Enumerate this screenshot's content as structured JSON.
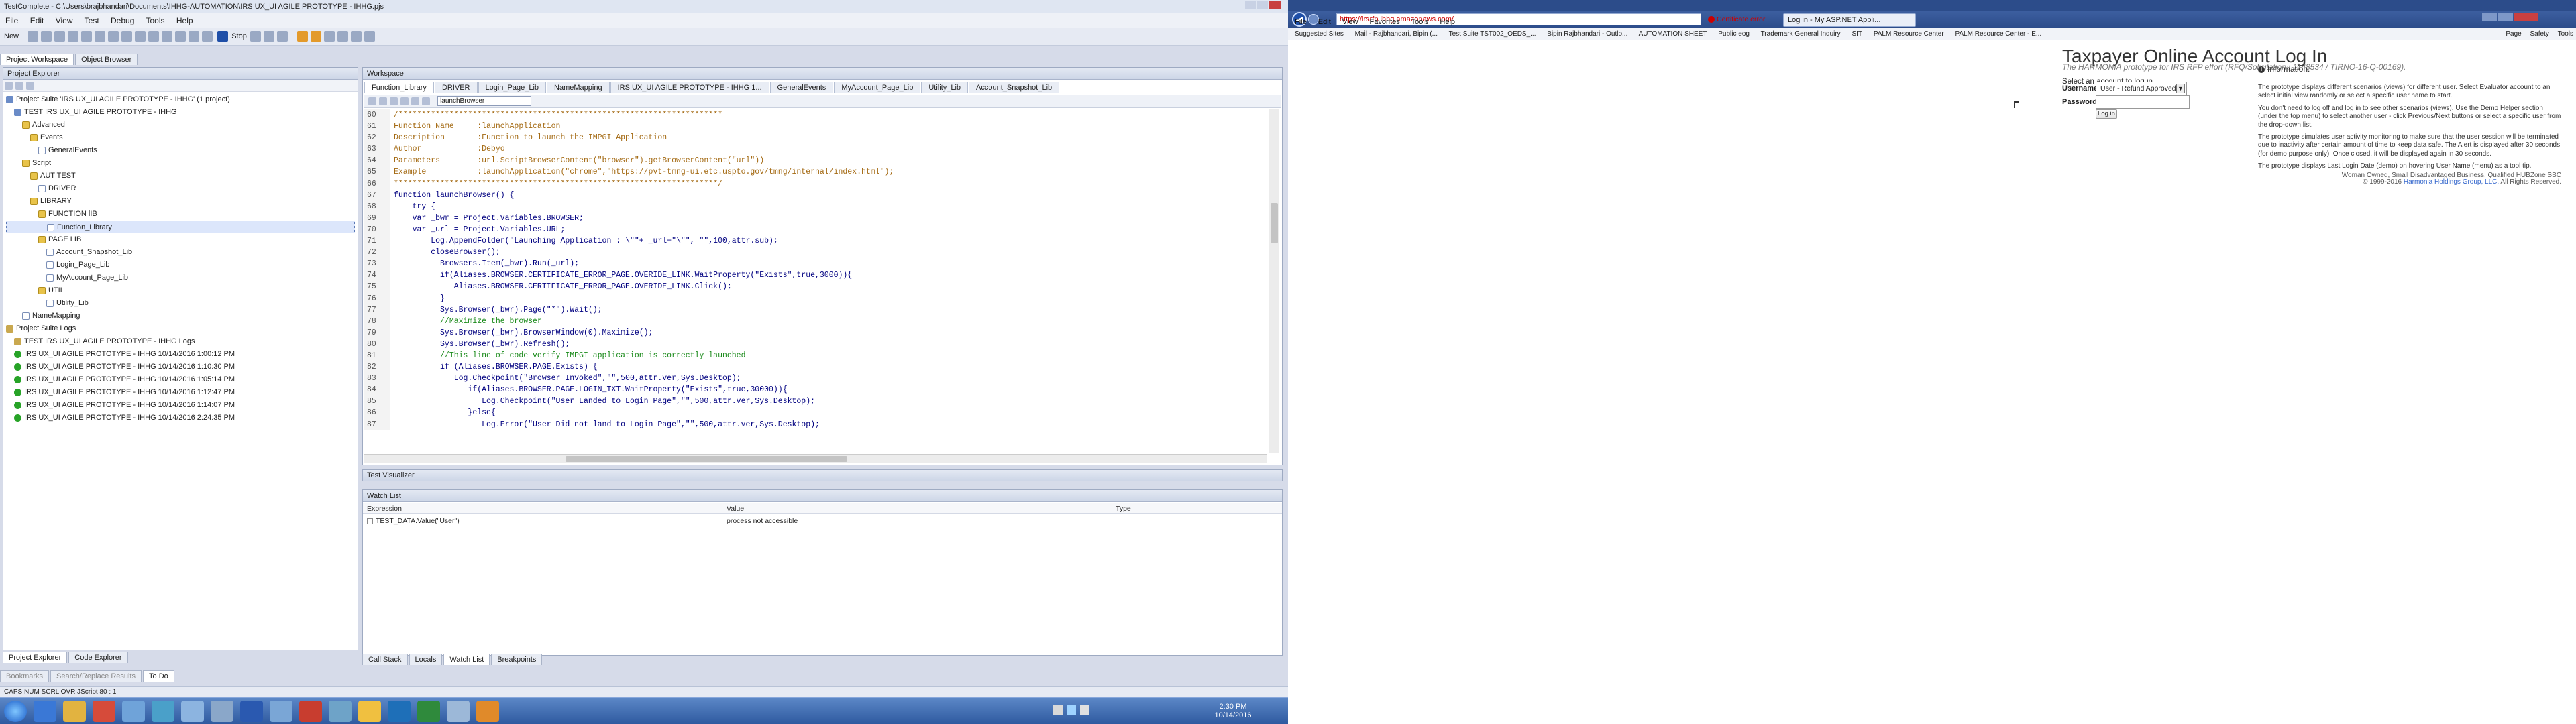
{
  "tc": {
    "title": "TestComplete - C:\\Users\\brajbhandari\\Documents\\IHHG-AUTOMATION\\IRS UX_UI AGILE PROTOTYPE - IHHG.pjs",
    "menu": [
      "File",
      "Edit",
      "View",
      "Test",
      "Debug",
      "Tools",
      "Help"
    ],
    "toolbar_new": "New",
    "toolbar_stop": "Stop",
    "panel_tabs": [
      "Project Workspace",
      "Object Browser"
    ],
    "project_explorer_title": "Project Explorer",
    "tree": [
      {
        "label": "Project Suite 'IRS UX_UI AGILE PROTOTYPE - IHHG' (1 project)",
        "level": 0,
        "icon": "suite"
      },
      {
        "label": "TEST IRS UX_UI AGILE PROTOTYPE - IHHG",
        "level": 1,
        "icon": "suite"
      },
      {
        "label": "Advanced",
        "level": 2,
        "icon": "folder"
      },
      {
        "label": "Events",
        "level": 3,
        "icon": "folder"
      },
      {
        "label": "GeneralEvents",
        "level": 4,
        "icon": "file"
      },
      {
        "label": "Script",
        "level": 2,
        "icon": "folder"
      },
      {
        "label": "AUT TEST",
        "level": 3,
        "icon": "folder"
      },
      {
        "label": "DRIVER",
        "level": 4,
        "icon": "file"
      },
      {
        "label": "LIBRARY",
        "level": 3,
        "icon": "folder"
      },
      {
        "label": "FUNCTION lIB",
        "level": 4,
        "icon": "folder"
      },
      {
        "label": "Function_Library",
        "level": 5,
        "icon": "file",
        "selected": true
      },
      {
        "label": "PAGE LIB",
        "level": 4,
        "icon": "folder"
      },
      {
        "label": "Account_Snapshot_Lib",
        "level": 5,
        "icon": "file"
      },
      {
        "label": "Login_Page_Lib",
        "level": 5,
        "icon": "file"
      },
      {
        "label": "MyAccount_Page_Lib",
        "level": 5,
        "icon": "file"
      },
      {
        "label": "UTIL",
        "level": 4,
        "icon": "folder"
      },
      {
        "label": "Utility_Lib",
        "level": 5,
        "icon": "file"
      },
      {
        "label": "NameMapping",
        "level": 2,
        "icon": "file"
      },
      {
        "label": "Project Suite Logs",
        "level": 0,
        "icon": "log"
      },
      {
        "label": "TEST IRS UX_UI AGILE PROTOTYPE - IHHG Logs",
        "level": 1,
        "icon": "log"
      },
      {
        "label": "IRS UX_UI AGILE PROTOTYPE - IHHG 10/14/2016 1:00:12 PM",
        "level": 1,
        "icon": "ok"
      },
      {
        "label": "IRS UX_UI AGILE PROTOTYPE - IHHG 10/14/2016 1:10:30 PM",
        "level": 1,
        "icon": "ok"
      },
      {
        "label": "IRS UX_UI AGILE PROTOTYPE - IHHG 10/14/2016 1:05:14 PM",
        "level": 1,
        "icon": "ok"
      },
      {
        "label": "IRS UX_UI AGILE PROTOTYPE - IHHG 10/14/2016 1:12:47 PM",
        "level": 1,
        "icon": "ok"
      },
      {
        "label": "IRS UX_UI AGILE PROTOTYPE - IHHG 10/14/2016 1:14:07 PM",
        "level": 1,
        "icon": "ok"
      },
      {
        "label": "IRS UX_UI AGILE PROTOTYPE - IHHG 10/14/2016 2:24:35 PM",
        "level": 1,
        "icon": "ok"
      }
    ],
    "explorer_bottom_tabs": [
      "Project Explorer",
      "Code Explorer"
    ],
    "extra_tabs": [
      "Bookmarks",
      "Search/Replace Results",
      "To Do"
    ],
    "workspace_title": "Workspace",
    "editor_tabs": [
      "Function_Library",
      "DRIVER",
      "Login_Page_Lib",
      "NameMapping",
      "IRS UX_UI AGILE PROTOTYPE - IHHG 1...",
      "GeneralEvents",
      "MyAccount_Page_Lib",
      "Utility_Lib",
      "Account_Snapshot_Lib"
    ],
    "routine_dropdown": "launchBrowser",
    "code_lines": [
      {
        "n": "60",
        "t": "/**********************************************************************",
        "k": "comment"
      },
      {
        "n": "61",
        "t": "Function Name     :launchApplication",
        "k": "comment"
      },
      {
        "n": "62",
        "t": "Description       :Function to launch the IMPGI Application",
        "k": "comment"
      },
      {
        "n": "63",
        "t": "Author            :Debyo",
        "k": "comment"
      },
      {
        "n": "64",
        "t": "Parameters        :url.ScriptBrowserContent(\"browser\").getBrowserContent(\"url\"))",
        "k": "comment"
      },
      {
        "n": "65",
        "t": "Example           :launchApplication(\"chrome\",\"https://pvt-tmng-ui.etc.uspto.gov/tmng/internal/index.html\");",
        "k": "comment"
      },
      {
        "n": "66",
        "t": "**********************************************************************/",
        "k": "comment"
      },
      {
        "n": "67",
        "t": "function launchBrowser() {",
        "k": "code"
      },
      {
        "n": "68",
        "t": "    try {",
        "k": "code"
      },
      {
        "n": "69",
        "t": "    var _bwr = Project.Variables.BROWSER;",
        "k": "code"
      },
      {
        "n": "70",
        "t": "    var _url = Project.Variables.URL;",
        "k": "code"
      },
      {
        "n": "71",
        "t": "        Log.AppendFolder(\"Launching Application : \\\"\"+ _url+\"\\\"\", \"\",100,attr.sub);",
        "k": "code"
      },
      {
        "n": "72",
        "t": "        closeBrowser();",
        "k": "code"
      },
      {
        "n": "73",
        "t": "          Browsers.Item(_bwr).Run(_url);",
        "k": "code"
      },
      {
        "n": "74",
        "t": "          if(Aliases.BROWSER.CERTIFICATE_ERROR_PAGE.OVERIDE_LINK.WaitProperty(\"Exists\",true,3000)){",
        "k": "code"
      },
      {
        "n": "75",
        "t": "             Aliases.BROWSER.CERTIFICATE_ERROR_PAGE.OVERIDE_LINK.Click();",
        "k": "code"
      },
      {
        "n": "76",
        "t": "          }",
        "k": "code"
      },
      {
        "n": "77",
        "t": "          Sys.Browser(_bwr).Page(\"*\").Wait();",
        "k": "code"
      },
      {
        "n": "78",
        "t": "          //Maximize the browser",
        "k": "green"
      },
      {
        "n": "79",
        "t": "          Sys.Browser(_bwr).BrowserWindow(0).Maximize();",
        "k": "code"
      },
      {
        "n": "80",
        "t": "          Sys.Browser(_bwr).Refresh();",
        "k": "code"
      },
      {
        "n": "81",
        "t": "          //This line of code verify IMPGI application is correctly launched",
        "k": "green"
      },
      {
        "n": "82",
        "t": "          if (Aliases.BROWSER.PAGE.Exists) {",
        "k": "code"
      },
      {
        "n": "83",
        "t": "             Log.Checkpoint(\"Browser Invoked\",\"\",500,attr.ver,Sys.Desktop);",
        "k": "code"
      },
      {
        "n": "84",
        "t": "                if(Aliases.BROWSER.PAGE.LOGIN_TXT.WaitProperty(\"Exists\",true,30000)){",
        "k": "code"
      },
      {
        "n": "85",
        "t": "                   Log.Checkpoint(\"User Landed to Login Page\",\"\",500,attr.ver,Sys.Desktop);",
        "k": "code"
      },
      {
        "n": "86",
        "t": "                }else{",
        "k": "code"
      },
      {
        "n": "87",
        "t": "                   Log.Error(\"User Did not land to Login Page\",\"\",500,attr.ver,Sys.Desktop);",
        "k": "code"
      }
    ],
    "test_visualizer": "Test Visualizer",
    "watch_list_title": "Watch List",
    "watch_columns": [
      "Expression",
      "Value",
      "Type"
    ],
    "watch_row": {
      "expression": "TEST_DATA.Value(\"User\")",
      "value": "process not accessible",
      "type": ""
    },
    "debug_tabs": [
      "Call Stack",
      "Locals",
      "Watch List",
      "Breakpoints"
    ],
    "status": "CAPS  NUM  SCRL  OVR  JScript     80 : 1"
  },
  "taskbar": {
    "time": "2:30 PM",
    "date": "10/14/2016"
  },
  "ie": {
    "address": "https://irsrfp.ihhg.amazonaws.com/",
    "cert_error": "Certificate error",
    "tab_title": "Log in - My ASP.NET Appli...",
    "menu": [
      "File",
      "Edit",
      "View",
      "Favorites",
      "Tools",
      "Help"
    ],
    "favorites": [
      "Suggested Sites",
      "Mail - Rajbhandari, Bipin (...",
      "Test Suite TST002_OEDS_...",
      "Bipin Rajbhandari - Outlo...",
      "AUTOMATION SHEET",
      "Public eog",
      "Trademark General Inquiry",
      "SIT",
      "PALM Resource Center",
      "PALM Resource Center - E..."
    ],
    "commands": [
      "Page",
      "Safety",
      "Tools"
    ]
  },
  "page": {
    "title": "Taxpayer Online Account Log In",
    "subtitle": "The HARMONIA prototype for IRS RFP effort (RFQ/Solicitation# 1148534 / TIRNO-16-Q-00169).",
    "select_prompt": "Select an account to log in.",
    "username_label": "Username",
    "username_value": "User - Refund Approved",
    "password_label": "Password",
    "password_value": "",
    "login_button": "Log in",
    "info_title": "Information.",
    "info_paragraphs": [
      "The prototype displays different scenarios (views) for different user. Select Evaluator account to an select initial view randomly or select a specific user name to start.",
      "You don't need to log off and log in to see other scenarios (views). Use the Demo Helper section (under the top menu) to select another user - click Previous/Next buttons or select a specific user from the drop-down list.",
      "The prototype simulates user activity monitoring to make sure that the user session will be terminated due to inactivity after certain amount of time to keep data safe. The Alert is displayed after 30 seconds (for demo purpose only). Once closed, it will be displayed again in 30 seconds.",
      "The prototype displays Last Login Date (demo) on hovering User Name (menu) as a tool tip."
    ],
    "footer_line1": "Woman Owned, Small Disadvantaged Business, Qualified HUBZone SBC",
    "footer_copy": "© 1999-2016",
    "footer_link": "Harmonia Holdings Group, LLC.",
    "footer_rights": "All Rights Reserved."
  }
}
